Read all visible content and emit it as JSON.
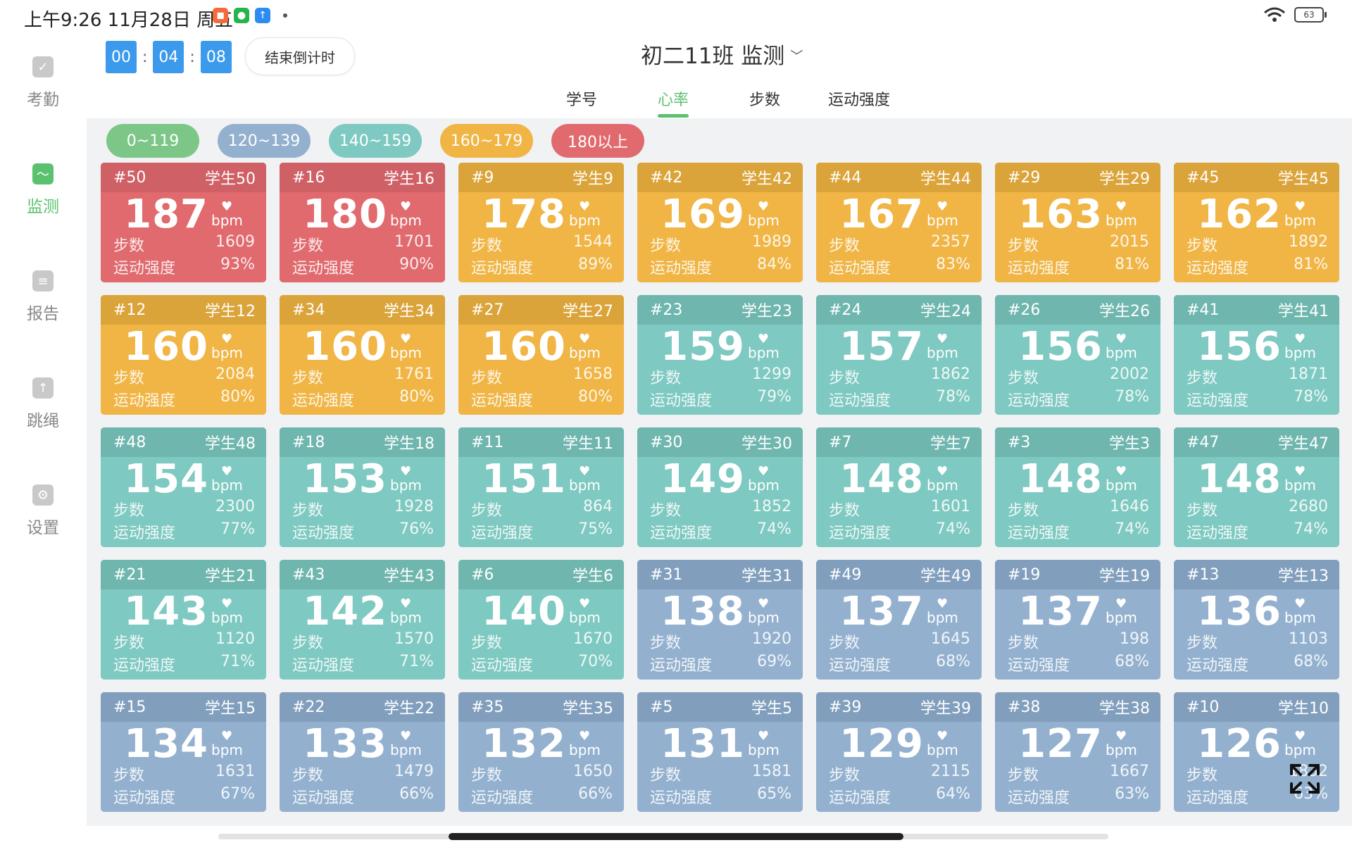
{
  "status_bar": {
    "time_text": "上午9:26 11月28日 周五",
    "apps": [
      {
        "name": "app-icon-orange",
        "color": "#f56b3a",
        "glyph": "◼"
      },
      {
        "name": "app-icon-green",
        "color": "#27b34e",
        "glyph": "●"
      },
      {
        "name": "app-icon-blue",
        "color": "#2d8cf0",
        "glyph": "↑"
      }
    ],
    "battery": "63"
  },
  "sidebar": {
    "items": [
      {
        "label": "考勤",
        "icon": "check-icon",
        "active": false
      },
      {
        "label": "监测",
        "icon": "monitor-icon",
        "active": true
      },
      {
        "label": "报告",
        "icon": "report-icon",
        "active": false
      },
      {
        "label": "跳绳",
        "icon": "jump-rope-icon",
        "active": false
      },
      {
        "label": "设置",
        "icon": "gear-icon",
        "active": false
      }
    ]
  },
  "timer": {
    "h": "00",
    "m": "04",
    "s": "08",
    "sep": ":"
  },
  "end_button": "结束倒计时",
  "class_title": "初二11班 监测",
  "tabs": [
    {
      "label": "学号",
      "active": false
    },
    {
      "label": "心率",
      "active": true
    },
    {
      "label": "步数",
      "active": false
    },
    {
      "label": "运动强度",
      "active": false
    }
  ],
  "legend": [
    {
      "label": "0~119",
      "color": "#7cc787"
    },
    {
      "label": "120~139",
      "color": "#93b1cf"
    },
    {
      "label": "140~159",
      "color": "#7ec9c1"
    },
    {
      "label": "160~179",
      "color": "#f0b545"
    },
    {
      "label": "180以上",
      "color": "#e06a6e"
    }
  ],
  "card_labels": {
    "steps": "步数",
    "intensity": "运动强度",
    "unit": "bpm"
  },
  "students": [
    {
      "num": "#50",
      "name": "学生50",
      "hr": 187,
      "steps": "1609",
      "intensity": "93%"
    },
    {
      "num": "#16",
      "name": "学生16",
      "hr": 180,
      "steps": "1701",
      "intensity": "90%"
    },
    {
      "num": "#9",
      "name": "学生9",
      "hr": 178,
      "steps": "1544",
      "intensity": "89%"
    },
    {
      "num": "#42",
      "name": "学生42",
      "hr": 169,
      "steps": "1989",
      "intensity": "84%"
    },
    {
      "num": "#44",
      "name": "学生44",
      "hr": 167,
      "steps": "2357",
      "intensity": "83%"
    },
    {
      "num": "#29",
      "name": "学生29",
      "hr": 163,
      "steps": "2015",
      "intensity": "81%"
    },
    {
      "num": "#45",
      "name": "学生45",
      "hr": 162,
      "steps": "1892",
      "intensity": "81%"
    },
    {
      "num": "#12",
      "name": "学生12",
      "hr": 160,
      "steps": "2084",
      "intensity": "80%"
    },
    {
      "num": "#34",
      "name": "学生34",
      "hr": 160,
      "steps": "1761",
      "intensity": "80%"
    },
    {
      "num": "#27",
      "name": "学生27",
      "hr": 160,
      "steps": "1658",
      "intensity": "80%"
    },
    {
      "num": "#23",
      "name": "学生23",
      "hr": 159,
      "steps": "1299",
      "intensity": "79%"
    },
    {
      "num": "#24",
      "name": "学生24",
      "hr": 157,
      "steps": "1862",
      "intensity": "78%"
    },
    {
      "num": "#26",
      "name": "学生26",
      "hr": 156,
      "steps": "2002",
      "intensity": "78%"
    },
    {
      "num": "#41",
      "name": "学生41",
      "hr": 156,
      "steps": "1871",
      "intensity": "78%"
    },
    {
      "num": "#48",
      "name": "学生48",
      "hr": 154,
      "steps": "2300",
      "intensity": "77%"
    },
    {
      "num": "#18",
      "name": "学生18",
      "hr": 153,
      "steps": "1928",
      "intensity": "76%"
    },
    {
      "num": "#11",
      "name": "学生11",
      "hr": 151,
      "steps": "864",
      "intensity": "75%"
    },
    {
      "num": "#30",
      "name": "学生30",
      "hr": 149,
      "steps": "1852",
      "intensity": "74%"
    },
    {
      "num": "#7",
      "name": "学生7",
      "hr": 148,
      "steps": "1601",
      "intensity": "74%"
    },
    {
      "num": "#3",
      "name": "学生3",
      "hr": 148,
      "steps": "1646",
      "intensity": "74%"
    },
    {
      "num": "#47",
      "name": "学生47",
      "hr": 148,
      "steps": "2680",
      "intensity": "74%"
    },
    {
      "num": "#21",
      "name": "学生21",
      "hr": 143,
      "steps": "1120",
      "intensity": "71%"
    },
    {
      "num": "#43",
      "name": "学生43",
      "hr": 142,
      "steps": "1570",
      "intensity": "71%"
    },
    {
      "num": "#6",
      "name": "学生6",
      "hr": 140,
      "steps": "1670",
      "intensity": "70%"
    },
    {
      "num": "#31",
      "name": "学生31",
      "hr": 138,
      "steps": "1920",
      "intensity": "69%"
    },
    {
      "num": "#49",
      "name": "学生49",
      "hr": 137,
      "steps": "1645",
      "intensity": "68%"
    },
    {
      "num": "#19",
      "name": "学生19",
      "hr": 137,
      "steps": "198",
      "intensity": "68%"
    },
    {
      "num": "#13",
      "name": "学生13",
      "hr": 136,
      "steps": "1103",
      "intensity": "68%"
    },
    {
      "num": "#15",
      "name": "学生15",
      "hr": 134,
      "steps": "1631",
      "intensity": "67%"
    },
    {
      "num": "#22",
      "name": "学生22",
      "hr": 133,
      "steps": "1479",
      "intensity": "66%"
    },
    {
      "num": "#35",
      "name": "学生35",
      "hr": 132,
      "steps": "1650",
      "intensity": "66%"
    },
    {
      "num": "#5",
      "name": "学生5",
      "hr": 131,
      "steps": "1581",
      "intensity": "65%"
    },
    {
      "num": "#39",
      "name": "学生39",
      "hr": 129,
      "steps": "2115",
      "intensity": "64%"
    },
    {
      "num": "#38",
      "name": "学生38",
      "hr": 127,
      "steps": "1667",
      "intensity": "63%"
    },
    {
      "num": "#10",
      "name": "学生10",
      "hr": 126,
      "steps": "1832",
      "intensity": "63%"
    }
  ],
  "colors": {
    "accent": "#5cc16f",
    "timer_blue": "#3b9aec",
    "zone_180_head": "#cf6066",
    "zone_160_head": "#dba43a",
    "zone_140_head": "#6fb6ae",
    "zone_120_head": "#819fbd"
  }
}
